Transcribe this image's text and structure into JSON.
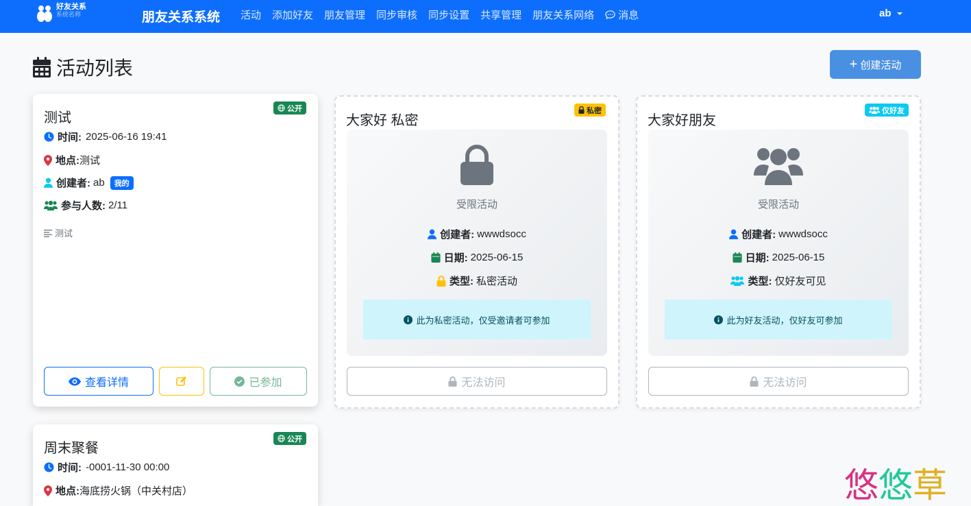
{
  "navbar": {
    "logo_title": "好友关系",
    "logo_sub": "系统名称",
    "brand": "朋友关系系统",
    "links": [
      "活动",
      "添加好友",
      "朋友管理",
      "同步审核",
      "同步设置",
      "共享管理",
      "朋友关系网络",
      "消息"
    ],
    "user": "ab"
  },
  "header": {
    "title": "活动列表",
    "create_label": "创建活动"
  },
  "cards": [
    {
      "title": "测试",
      "badge": "公开",
      "time_label": "时间:",
      "time": "2025-06-16 19:41",
      "place_label": "地点:",
      "place": "测试",
      "creator_label": "创建者:",
      "creator": "ab",
      "mine": "我的",
      "count_label": "参与人数:",
      "count": "2/11",
      "desc": "测试",
      "view_label": "查看详情",
      "joined_label": "已参加"
    },
    {
      "title": "大家好 私密",
      "badge": "私密",
      "restricted": "受限活动",
      "creator_label": "创建者:",
      "creator": "wwwdsocc",
      "date_label": "日期:",
      "date": "2025-06-15",
      "type_label": "类型:",
      "type": "私密活动",
      "notice": "此为私密活动，仅受邀请者可参加",
      "denied_label": "无法访问"
    },
    {
      "title": "大家好朋友",
      "badge": "仅好友",
      "restricted": "受限活动",
      "creator_label": "创建者:",
      "creator": "wwwdsocc",
      "date_label": "日期:",
      "date": "2025-06-15",
      "type_label": "类型:",
      "type": "仅好友可见",
      "notice": "此为好友活动，仅好友可参加",
      "denied_label": "无法访问"
    },
    {
      "title": "周末聚餐",
      "badge": "公开",
      "time_label": "时间:",
      "time": "-0001-11-30 00:00",
      "place_label": "地点:",
      "place": "海底捞火锅（中关村店）"
    }
  ],
  "watermark": [
    "悠",
    "悠",
    "草"
  ],
  "colors": {
    "primary": "#0d6efd",
    "success": "#198754",
    "warning": "#ffc107",
    "info": "#0dcaf0",
    "danger": "#dc3545"
  }
}
